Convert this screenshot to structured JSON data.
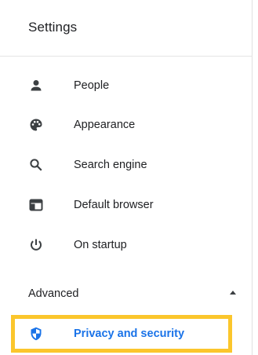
{
  "header": {
    "title": "Settings"
  },
  "nav": {
    "items": [
      {
        "label": "People",
        "icon": "person-icon"
      },
      {
        "label": "Appearance",
        "icon": "palette-icon"
      },
      {
        "label": "Search engine",
        "icon": "search-icon"
      },
      {
        "label": "Default browser",
        "icon": "browser-window-icon"
      },
      {
        "label": "On startup",
        "icon": "power-icon"
      }
    ]
  },
  "advanced": {
    "label": "Advanced",
    "expanded": true,
    "icon": "caret-up-icon",
    "items": [
      {
        "label": "Privacy and security",
        "icon": "shield-icon",
        "selected": true
      }
    ]
  },
  "colors": {
    "accent": "#1a73e8",
    "highlight_border": "#fbc62c",
    "icon": "#3c4043",
    "text": "#202124"
  }
}
